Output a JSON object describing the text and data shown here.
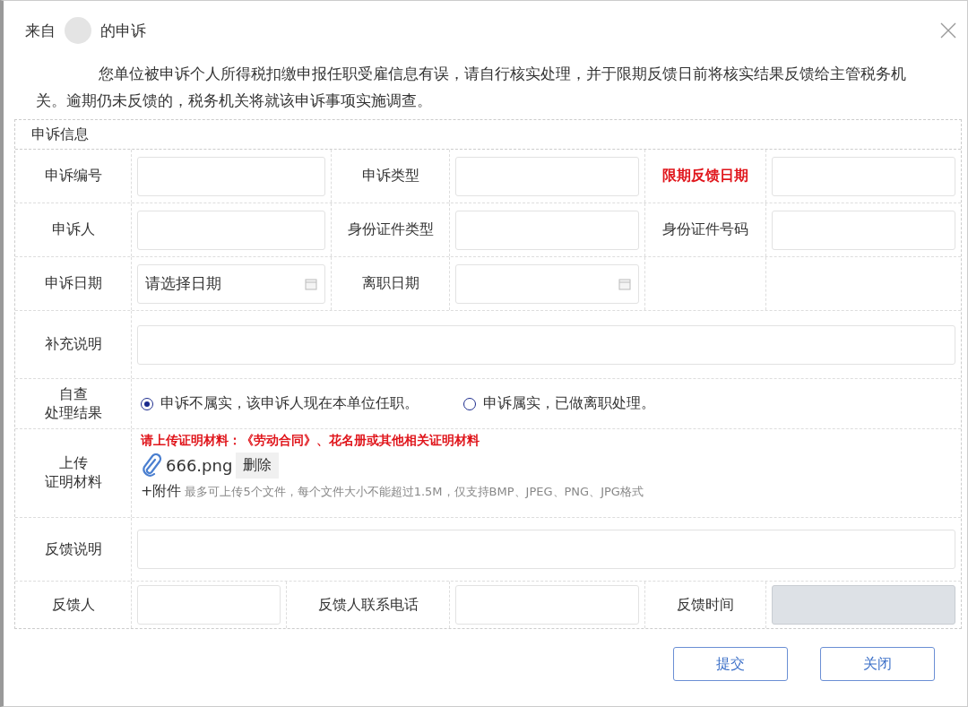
{
  "dialog": {
    "title_prefix": "来自",
    "title_suffix": "的申诉",
    "notice": "您单位被申诉个人所得税扣缴申报任职受雇信息有误，请自行核实处理，并于限期反馈日前将核实结果反馈给主管税务机关。逾期仍未反馈的，税务机关将就该申诉事项实施调查。"
  },
  "section": {
    "title": "申诉信息"
  },
  "grid_rows": [
    {
      "cells": [
        {
          "label": "申诉编号",
          "highlight": false,
          "field": {
            "kind": "text"
          }
        },
        {
          "label": "申诉类型",
          "highlight": false,
          "field": {
            "kind": "text"
          }
        },
        {
          "label": "限期反馈日期",
          "highlight": true,
          "field": {
            "kind": "text"
          }
        }
      ]
    },
    {
      "cells": [
        {
          "label": "申诉人",
          "highlight": false,
          "field": {
            "kind": "text"
          }
        },
        {
          "label": "身份证件类型",
          "highlight": false,
          "field": {
            "kind": "text"
          }
        },
        {
          "label": "身份证件号码",
          "highlight": false,
          "field": {
            "kind": "text"
          }
        }
      ]
    },
    {
      "cells": [
        {
          "label": "申诉日期",
          "highlight": false,
          "field": {
            "kind": "date",
            "placeholder": "请选择日期"
          }
        },
        {
          "label": "离职日期",
          "highlight": false,
          "field": {
            "kind": "date"
          }
        },
        {
          "field": {
            "kind": "none"
          }
        }
      ]
    }
  ],
  "supplement": {
    "label": "补充说明"
  },
  "result": {
    "label_lines": [
      "自查",
      "处理结果"
    ],
    "options": [
      {
        "label": "申诉不属实，该申诉人现在本单位任职。",
        "selected": true
      },
      {
        "label": "申诉属实，已做离职处理。",
        "selected": false
      }
    ]
  },
  "upload": {
    "label_lines": [
      "上传",
      "证明材料"
    ],
    "note": "请上传证明材料：《劳动合同》、花名册或其他相关证明材料",
    "files": [
      {
        "name": "666.png",
        "delete": "删除"
      }
    ],
    "add": "+附件",
    "hint": "最多可上传5个文件，每个文件大小不能超过1.5M，仅支持BMP、JPEG、PNG、JPG格式"
  },
  "feedback": {
    "label": "反馈说明"
  },
  "feedback_row": [
    {
      "label": "反馈人",
      "disabled": false
    },
    {
      "label": "反馈人联系电话",
      "disabled": false
    },
    {
      "label": "反馈时间",
      "disabled": true
    }
  ],
  "buttons": [
    {
      "label": "提交"
    },
    {
      "label": "关闭"
    }
  ]
}
